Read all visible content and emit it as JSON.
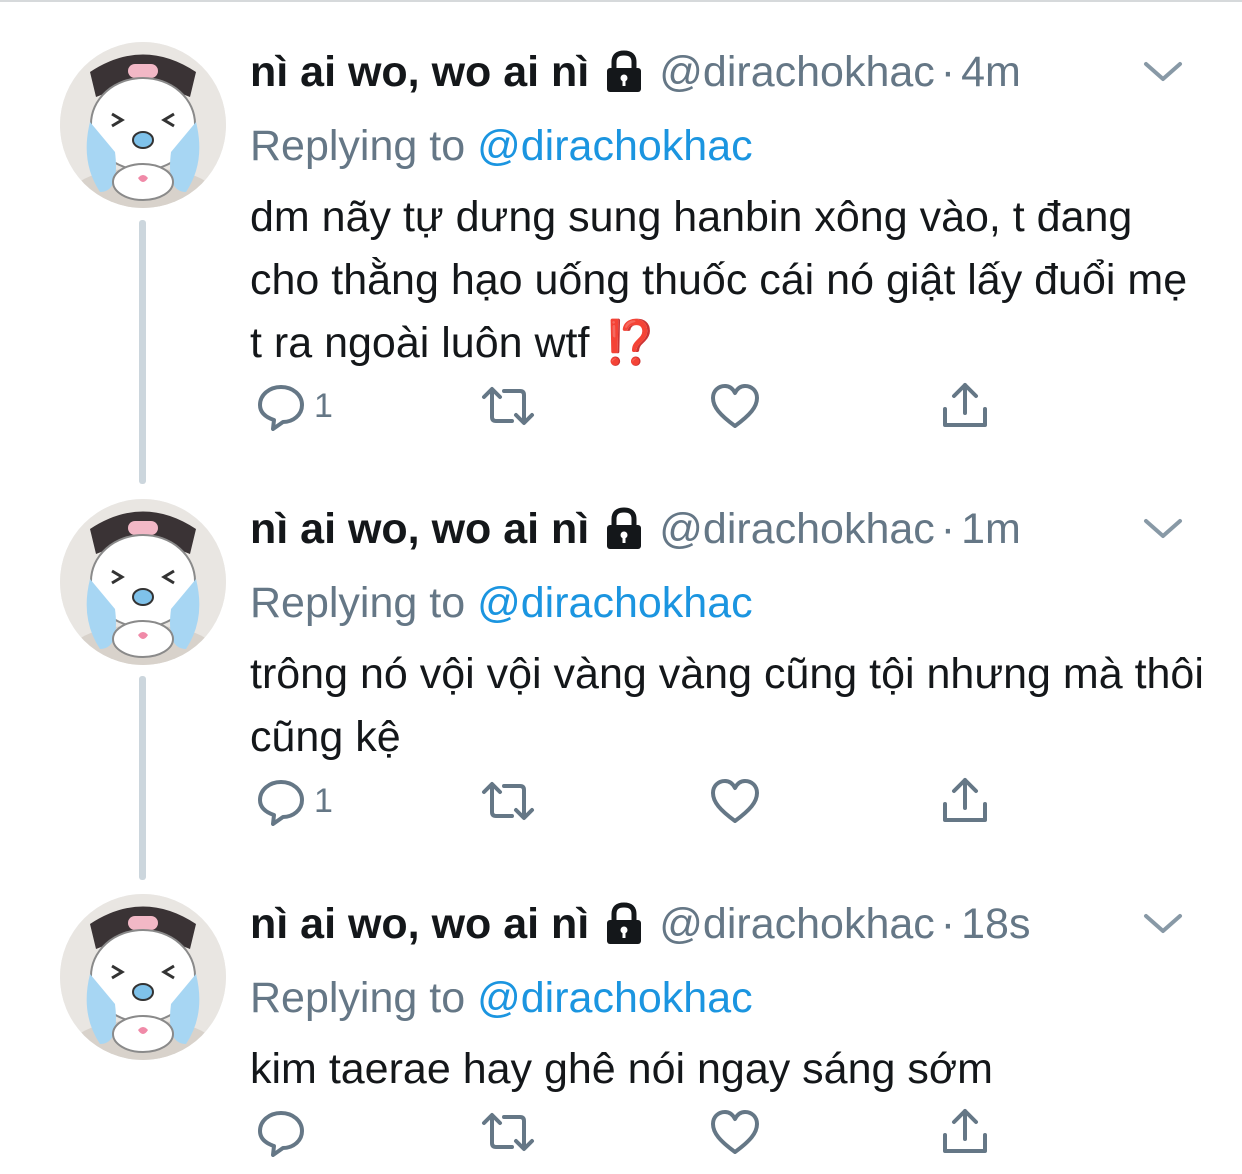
{
  "tweets": [
    {
      "display_name": "nì ai wo, wo ai nì",
      "handle": "@dirachokhac",
      "separator": "·",
      "time": "4m",
      "replying_prefix": "Replying to",
      "replying_to": "@dirachokhac",
      "text": "dm nãy tự dưng sung hanbin xông vào, t đang cho thằng hạo uống thuốc cái nó giật lấy đuổi mẹ t ra ngoài luôn wtf",
      "emoji": "⁉️",
      "reply_count": "1"
    },
    {
      "display_name": "nì ai wo, wo ai nì",
      "handle": "@dirachokhac",
      "separator": "·",
      "time": "1m",
      "replying_prefix": "Replying to",
      "replying_to": "@dirachokhac",
      "text": "trông nó vội vội vàng vàng cũng tội nhưng mà thôi cũng kệ",
      "reply_count": "1"
    },
    {
      "display_name": "nì ai wo, wo ai nì",
      "handle": "@dirachokhac",
      "separator": "·",
      "time": "18s",
      "replying_prefix": "Replying to",
      "replying_to": "@dirachokhac",
      "text": "kim taerae hay ghê nói ngay sáng sớm",
      "reply_count": ""
    }
  ],
  "icons": {
    "reply": "reply-icon",
    "retweet": "retweet-icon",
    "like": "heart-icon",
    "share": "share-icon",
    "more": "chevron-down-icon",
    "protected": "lock-icon"
  },
  "colors": {
    "text": "#14171a",
    "secondary": "#657786",
    "link": "#1b95e0",
    "thread_line": "#ccd6dd",
    "interrobang": "#d13a1e"
  }
}
